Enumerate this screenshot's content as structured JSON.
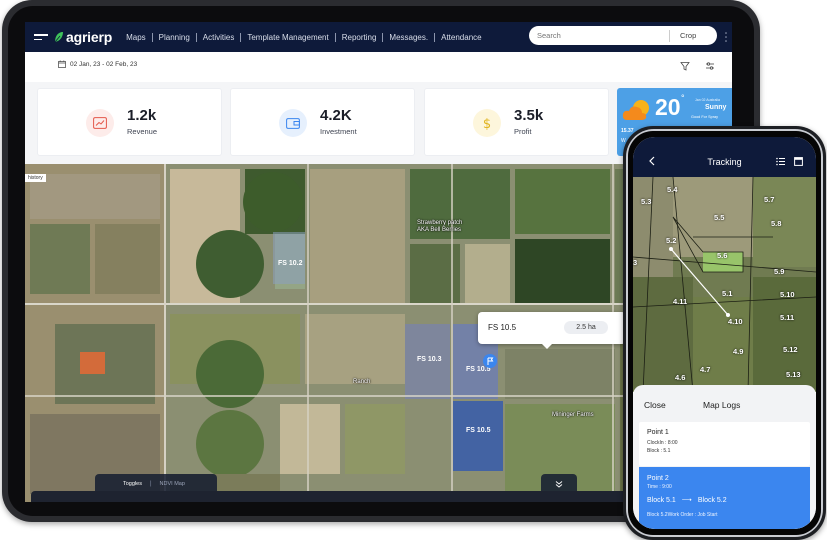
{
  "app": {
    "logo_prefix": "agri",
    "logo_suffix": "erp",
    "nav": [
      "Maps",
      "Planning",
      "Activities",
      "Template Management",
      "Reporting",
      "Messages.",
      "Attendance"
    ],
    "search_placeholder": "Search",
    "crop_select": "Crop"
  },
  "filters": {
    "date_range": "02 Jan, 23 - 02 Feb, 23"
  },
  "stats": [
    {
      "value": "1.2k",
      "label": "Revenue",
      "icon": "trend-up-icon",
      "color": "#e4574a",
      "bg": "#fdecea"
    },
    {
      "value": "4.2K",
      "label": "Investment",
      "icon": "wallet-icon",
      "color": "#3b86ef",
      "bg": "#e6f0fd"
    },
    {
      "value": "3.5k",
      "label": "Profit",
      "icon": "dollar-icon",
      "color": "#e0b31c",
      "bg": "#fdf6dc"
    }
  ],
  "weather": {
    "temp": "20",
    "degree": "°",
    "location": "Jan 02 Australia",
    "condition": "Sunny",
    "advice": "Good For Spray",
    "reading": "15.37",
    "reading_sub": "W"
  },
  "map": {
    "history_tab": "history",
    "fields": [
      {
        "id": "fs-10-2",
        "label": "FS 10.2"
      },
      {
        "id": "fs-10-3",
        "label": "FS 10.3"
      },
      {
        "id": "fs-10-5a",
        "label": "FS 10.5"
      },
      {
        "id": "fs-10-5b",
        "label": "FS 10.5"
      }
    ],
    "places": [
      "Strawberry patch",
      "AKA Bell Berries",
      "Mininger Farms",
      "Ranch"
    ],
    "popup": {
      "title": "FS 10.5",
      "area": "2.5 ha"
    },
    "toggles_label": "Toggles",
    "ndvi_label": "NDVI Map"
  },
  "phone": {
    "title": "Tracking",
    "blocks": [
      "5.3",
      "5.4",
      "5.7",
      "5.5",
      "5.8",
      "5.2",
      "5.6",
      "5.9",
      "5.1",
      "5.10",
      "4.11",
      "5.11",
      "4.10",
      "4.9",
      "5.12",
      "4.7",
      "4.6",
      "5.13",
      "3"
    ],
    "sheet": {
      "close_label": "Close",
      "title": "Map Logs",
      "logs": [
        {
          "title": "Point 1",
          "line1": "ClockIn : 8:00",
          "line2": "Block : 5.1"
        },
        {
          "title": "Point 2",
          "time": "Time : 9:00",
          "from": "Block 5.1",
          "arrow": "⟶",
          "to": "Block 5.2",
          "order": "Block 5.2Work Order : Job Start"
        }
      ]
    }
  }
}
